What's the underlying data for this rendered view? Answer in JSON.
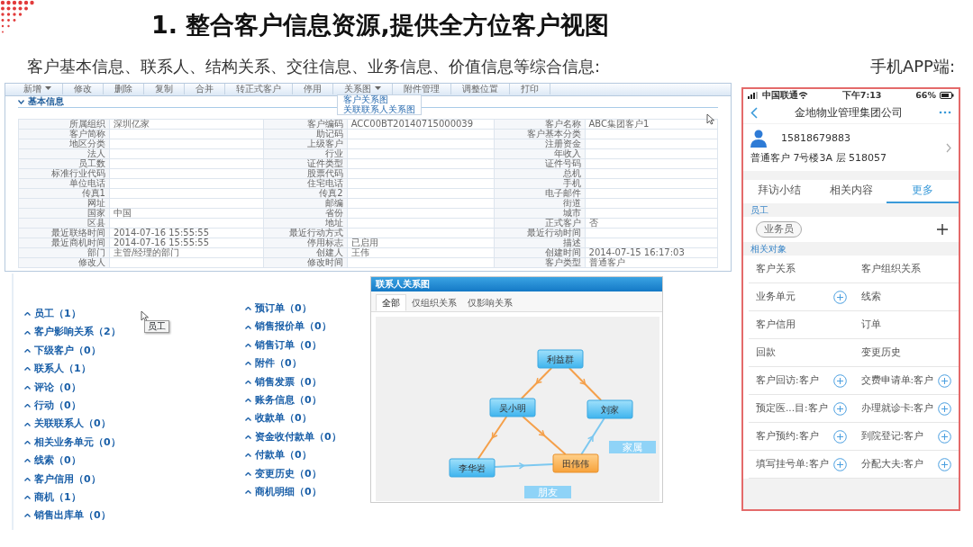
{
  "slide": {
    "title": "1. 整合客户信息资源,提供全方位客户视图",
    "subtitle": "客户基本信息、联系人、结构关系、交往信息、业务信息、价值信息等综合信息:",
    "mobile_label": "手机APP端:"
  },
  "customer_form": {
    "toolbar": [
      {
        "label": "新增",
        "caret": true
      },
      {
        "label": "修改",
        "caret": false
      },
      {
        "label": "删除",
        "caret": false
      },
      {
        "label": "复制",
        "caret": false
      },
      {
        "label": "合并",
        "caret": false
      },
      {
        "label": "转正式客户",
        "caret": false
      },
      {
        "label": "停用",
        "caret": false
      },
      {
        "label": "关系图",
        "caret": true
      },
      {
        "label": "附件管理",
        "caret": false
      },
      {
        "label": "调整位置",
        "caret": false
      },
      {
        "label": "打印",
        "caret": false
      }
    ],
    "open_menu": {
      "items": [
        "客户关系图",
        "关联联系人关系图"
      ]
    },
    "section": {
      "title": "基本信息",
      "expanded": true
    },
    "rows": [
      [
        {
          "label": "所属组织",
          "value": "深圳亿家"
        },
        {
          "label": "客户编码",
          "value": "ACC00BT20140715000039"
        },
        {
          "label": "客户名称",
          "value": "ABC集团客户1"
        }
      ],
      [
        {
          "label": "客户简称"
        },
        {
          "label": "助记码"
        },
        {
          "label": "客户基本分类"
        }
      ],
      [
        {
          "label": "地区分类"
        },
        {
          "label": "上级客户"
        },
        {
          "label": "注册资金"
        }
      ],
      [
        {
          "label": "法人"
        },
        {
          "label": "行业"
        },
        {
          "label": "年收入"
        }
      ],
      [
        {
          "label": "员工数"
        },
        {
          "label": "证件类型"
        },
        {
          "label": "证件号码"
        }
      ],
      [
        {
          "label": "标准行业代码"
        },
        {
          "label": "股票代码"
        },
        {
          "label": "总机"
        }
      ],
      [
        {
          "label": "单位电话"
        },
        {
          "label": "住宅电话"
        },
        {
          "label": "手机"
        }
      ],
      [
        {
          "label": "传真1"
        },
        {
          "label": "传真2"
        },
        {
          "label": "电子邮件"
        }
      ],
      [
        {
          "label": "网址"
        },
        {
          "label": "邮编"
        },
        {
          "label": "街道"
        }
      ],
      [
        {
          "label": "国家",
          "value": "中国"
        },
        {
          "label": "省份"
        },
        {
          "label": "城市"
        }
      ],
      [
        {
          "label": "区县"
        },
        {
          "label": "地址"
        },
        {
          "label": "正式客户",
          "value": "否"
        }
      ],
      [
        {
          "label": "最近联络时间",
          "value": "2014-07-16 15:55:55"
        },
        {
          "label": "最近行动方式"
        },
        {
          "label": "最近行动时间"
        }
      ],
      [
        {
          "label": "最近商机时间",
          "value": "2014-07-16 15:55:55"
        },
        {
          "label": "停用标志",
          "value": "已启用"
        },
        {
          "label": "描述"
        }
      ],
      [
        {
          "label": "部门",
          "value": "主管/经理的部门"
        },
        {
          "label": "创建人",
          "value": "王伟"
        },
        {
          "label": "创建时间",
          "value": "2014-07-15 16:17:03"
        }
      ],
      [
        {
          "label": "修改人"
        },
        {
          "label": "修改时间"
        },
        {
          "label": "客户类型",
          "value": "普通客户"
        }
      ]
    ]
  },
  "related_lists": {
    "tooltip": "员工",
    "left": [
      "员工（1）",
      "客户影响关系（2）",
      "下级客户（0）",
      "联系人（1）",
      "评论（0）",
      "行动（0）",
      "关联联系人（0）",
      "相关业务单元（0）",
      "线索（0）",
      "客户信用（0）",
      "商机（1）",
      "销售出库单（0）"
    ],
    "right": [
      "预订单（0）",
      "销售报价单（0）",
      "销售订单（0）",
      "附件（0）",
      "销售发票（0）",
      "账务信息（0）",
      "收款单（0）",
      "资金收付款单（0）",
      "付款单（0）",
      "变更历史（0）",
      "商机明细（0）"
    ]
  },
  "contact_graph": {
    "title": "联系人关系图",
    "tabs": [
      {
        "label": "全部",
        "selected": true
      },
      {
        "label": "仅组织关系",
        "selected": false
      },
      {
        "label": "仅影响关系",
        "selected": false
      }
    ],
    "nodes": [
      {
        "label": "利益群",
        "selected": false
      },
      {
        "label": "吴小明",
        "selected": false
      },
      {
        "label": "刘家",
        "selected": false
      },
      {
        "label": "李华岩",
        "selected": false
      },
      {
        "label": "田伟伟",
        "selected": true
      }
    ],
    "edges": [
      {
        "color": "#f5a04a"
      },
      {
        "color": "#f5a04a"
      },
      {
        "color": "#f5a04a"
      },
      {
        "color": "#f5a04a"
      },
      {
        "color": "#7cc8f0",
        "label": "朋友"
      },
      {
        "color": "#7cc8f0",
        "label": "家属"
      }
    ]
  },
  "mobile_app": {
    "status_bar": {
      "carrier": "中国联通",
      "time": "下午7:13",
      "battery": "66%"
    },
    "nav_title": "金地物业管理集团公司",
    "profile": {
      "phone": "15818679883",
      "details": "普通客户  7号楼3A 层 518057"
    },
    "tabs": [
      {
        "label": "拜访小结",
        "selected": false
      },
      {
        "label": "相关内容",
        "selected": false
      },
      {
        "label": "更多",
        "selected": true
      }
    ],
    "staff_section": {
      "title": "员工",
      "chips": [
        "业务员"
      ]
    },
    "related_section": {
      "title": "相关对象",
      "items": [
        {
          "label": "客户关系",
          "addable": false
        },
        {
          "label": "客户组织关系",
          "addable": false
        },
        {
          "label": "业务单元",
          "addable": true
        },
        {
          "label": "线索",
          "addable": false
        },
        {
          "label": "客户信用",
          "addable": false
        },
        {
          "label": "订单",
          "addable": false
        },
        {
          "label": "回款",
          "addable": false
        },
        {
          "label": "变更历史",
          "addable": false
        },
        {
          "label": "客户回访:客户",
          "addable": true
        },
        {
          "label": "交费申请单:客户",
          "addable": true
        },
        {
          "label": "预定医...目:客户",
          "addable": true
        },
        {
          "label": "办理就诊卡:客户",
          "addable": true
        },
        {
          "label": "客户预约:客户",
          "addable": true
        },
        {
          "label": "到院登记:客户",
          "addable": true
        },
        {
          "label": "填写挂号单:客户",
          "addable": true
        },
        {
          "label": "分配大夫:客户",
          "addable": true
        }
      ]
    }
  }
}
